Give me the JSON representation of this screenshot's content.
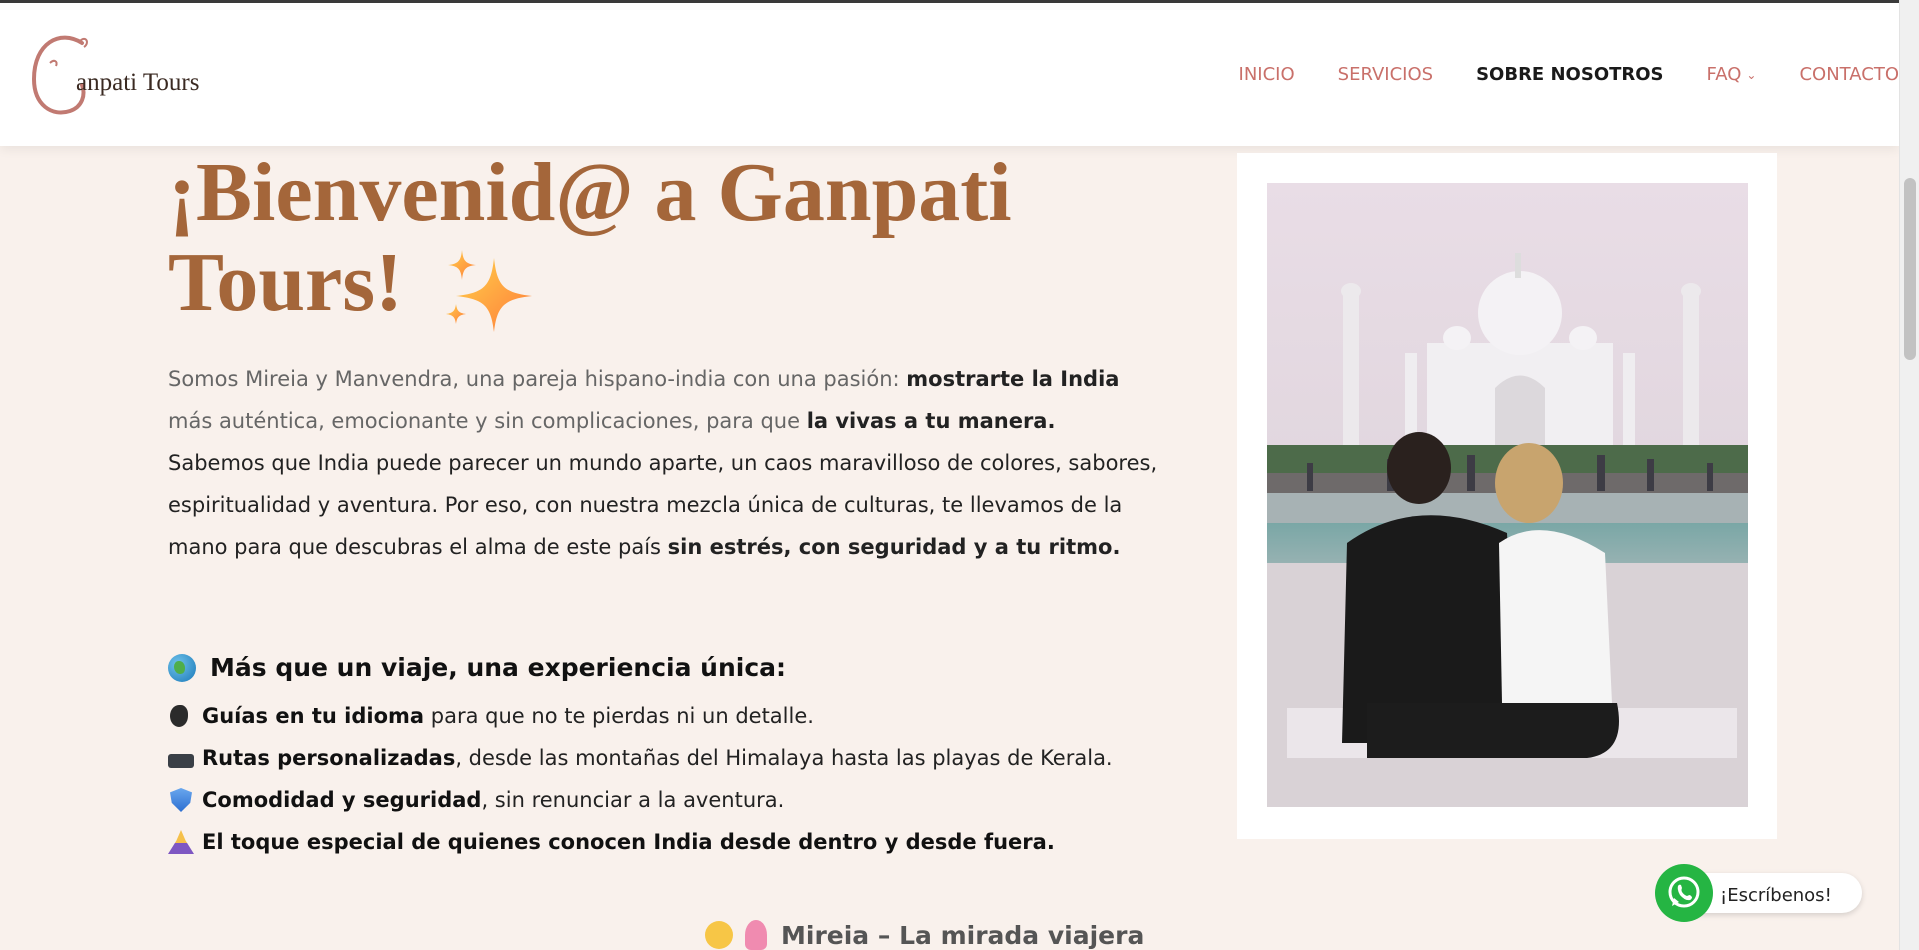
{
  "header": {
    "logo_text": "anpati Tours",
    "nav": [
      {
        "label": "INICIO",
        "active": false
      },
      {
        "label": "SERVICIOS",
        "active": false
      },
      {
        "label": "SOBRE NOSOTROS",
        "active": true
      },
      {
        "label": "FAQ",
        "active": false,
        "has_dropdown": true
      },
      {
        "label": "CONTACTO",
        "active": false
      }
    ]
  },
  "hero": {
    "title_line1": "¡Bienvenid@ a Ganpati",
    "title_line2": "Tours!",
    "title_icon": "sparkles-icon",
    "intro": {
      "p1_a": "Somos Mireia y Manvendra, una pareja hispano-india con una pasión: ",
      "p1_b": "mostrarte la India",
      "p1_c": "más auténtica, emocionante y sin complicaciones, para que ",
      "p1_d": "la vivas a tu manera.",
      "p2_a": "Sabemos que India puede parecer un mundo aparte, un caos maravilloso de colores, sabores, espiritualidad y aventura. Por eso, con nuestra mezcla única de culturas, te llevamos de la mano para que descubras el alma de este país ",
      "p2_b": "sin estrés, con seguridad y a tu ritmo."
    },
    "experience_heading": "Más que un viaje, una experiencia única:",
    "features": [
      {
        "icon": "speaking-head-icon",
        "bold": "Guías en tu idioma",
        "text": " para que no te pierdas ni un detalle."
      },
      {
        "icon": "bed-icon",
        "bold": "Rutas personalizadas",
        "text": ", desde las montañas del Himalaya hasta las playas de Kerala."
      },
      {
        "icon": "shield-icon",
        "bold": "Comodidad y seguridad",
        "text": ", sin renunciar a la aventura."
      },
      {
        "icon": "praying-hands-icon",
        "bold": "El toque especial de quienes conocen India desde dentro y desde fuera.",
        "text": ""
      }
    ],
    "next_heading": "Mireia – La mirada viajera"
  },
  "photo": {
    "subject": "Couple sitting in front of the Taj Mahal"
  },
  "whatsapp": {
    "label": "¡Escríbenos!"
  },
  "colors": {
    "accent": "#c9706a",
    "title": "#a4663a",
    "background": "#f9f1ec",
    "whatsapp": "#25b543"
  }
}
